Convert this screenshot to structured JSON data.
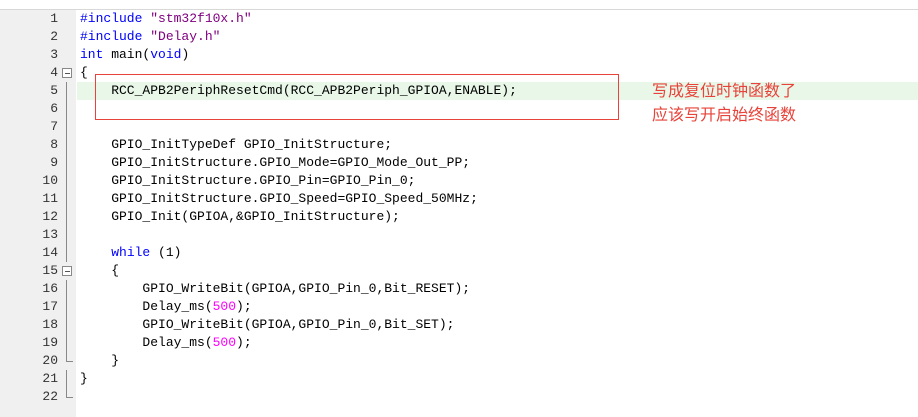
{
  "editor": {
    "lines": [
      {
        "n": "1",
        "tokens": [
          {
            "t": "#include ",
            "c": "kw"
          },
          {
            "t": "\"stm32f10x.h\"",
            "c": "str"
          }
        ]
      },
      {
        "n": "2",
        "tokens": [
          {
            "t": "#include ",
            "c": "kw"
          },
          {
            "t": "\"Delay.h\"",
            "c": "str"
          }
        ]
      },
      {
        "n": "3",
        "tokens": [
          {
            "t": "int",
            "c": "kw"
          },
          {
            "t": " main(",
            "c": ""
          },
          {
            "t": "void",
            "c": "kw"
          },
          {
            "t": ")",
            "c": ""
          }
        ]
      },
      {
        "n": "4",
        "tokens": [
          {
            "t": "{",
            "c": ""
          }
        ]
      },
      {
        "n": "5",
        "tokens": [
          {
            "t": "    RCC_APB2PeriphResetCmd(RCC_APB2Periph_GPIOA,ENABLE);",
            "c": ""
          }
        ]
      },
      {
        "n": "6",
        "tokens": []
      },
      {
        "n": "7",
        "tokens": []
      },
      {
        "n": "8",
        "tokens": [
          {
            "t": "    GPIO_InitTypeDef GPIO_InitStructure;",
            "c": ""
          }
        ]
      },
      {
        "n": "9",
        "tokens": [
          {
            "t": "    GPIO_InitStructure.GPIO_Mode=GPIO_Mode_Out_PP;",
            "c": ""
          }
        ]
      },
      {
        "n": "10",
        "tokens": [
          {
            "t": "    GPIO_InitStructure.GPIO_Pin=GPIO_Pin_0;",
            "c": ""
          }
        ]
      },
      {
        "n": "11",
        "tokens": [
          {
            "t": "    GPIO_InitStructure.GPIO_Speed=GPIO_Speed_50MHz;",
            "c": ""
          }
        ]
      },
      {
        "n": "12",
        "tokens": [
          {
            "t": "    GPIO_Init(GPIOA,&GPIO_InitStructure);",
            "c": ""
          }
        ]
      },
      {
        "n": "13",
        "tokens": []
      },
      {
        "n": "14",
        "tokens": [
          {
            "t": "    ",
            "c": ""
          },
          {
            "t": "while",
            "c": "kw"
          },
          {
            "t": " (1)",
            "c": ""
          }
        ]
      },
      {
        "n": "15",
        "tokens": [
          {
            "t": "    {",
            "c": ""
          }
        ]
      },
      {
        "n": "16",
        "tokens": [
          {
            "t": "        GPIO_WriteBit(GPIOA,GPIO_Pin_0,Bit_RESET);",
            "c": ""
          }
        ]
      },
      {
        "n": "17",
        "tokens": [
          {
            "t": "        Delay_ms(",
            "c": ""
          },
          {
            "t": "500",
            "c": "num"
          },
          {
            "t": ");",
            "c": ""
          }
        ]
      },
      {
        "n": "18",
        "tokens": [
          {
            "t": "        GPIO_WriteBit(GPIOA,GPIO_Pin_0,Bit_SET);",
            "c": ""
          }
        ]
      },
      {
        "n": "19",
        "tokens": [
          {
            "t": "        Delay_ms(",
            "c": ""
          },
          {
            "t": "500",
            "c": "num"
          },
          {
            "t": ");",
            "c": ""
          }
        ]
      },
      {
        "n": "20",
        "tokens": [
          {
            "t": "    }",
            "c": ""
          }
        ]
      },
      {
        "n": "21",
        "tokens": [
          {
            "t": "}",
            "c": ""
          }
        ]
      },
      {
        "n": "22",
        "tokens": []
      }
    ],
    "highlighted_line": "5",
    "fold_open_lines": [
      "4",
      "15"
    ],
    "fold_end_lines": [
      "20",
      "22"
    ],
    "fold_mid_lines": [
      "5",
      "6",
      "7",
      "8",
      "9",
      "10",
      "11",
      "12",
      "13",
      "14",
      "16",
      "17",
      "18",
      "19",
      "21"
    ]
  },
  "annotation": {
    "line1": "写成复位时钟函数了",
    "line2": "应该写开启始终函数",
    "color": "#e8433a"
  },
  "colors": {
    "keyword": "#0000ff",
    "string": "#800080",
    "number": "#ff00ff",
    "highlight": "#e8f7e8",
    "gutter": "#f0f0f0"
  }
}
